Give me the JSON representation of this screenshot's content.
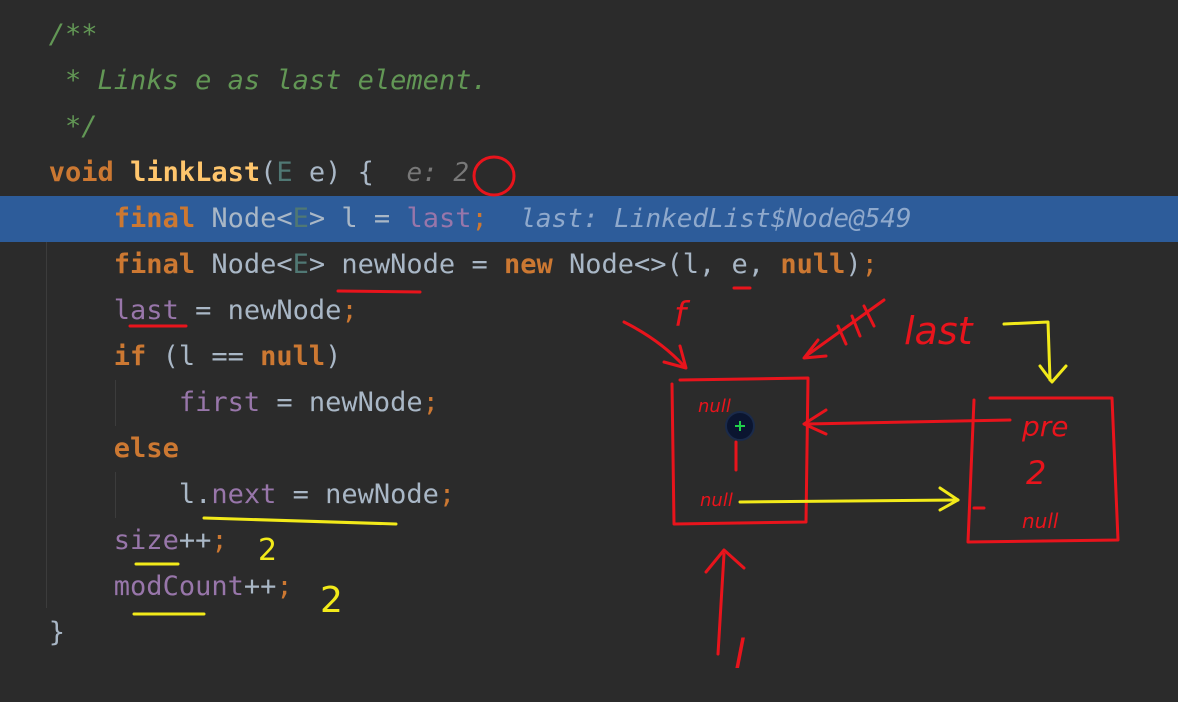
{
  "editor": {
    "line1": "/**",
    "line2": " * Links e as last element.",
    "line3": " */",
    "line4": {
      "kw": "void",
      "method": "linkLast",
      "open": "(",
      "type": "E",
      "param": " e) {",
      "hint": "e: 2"
    },
    "line5": {
      "kw": "final",
      "type": "Node<",
      "gen": "E",
      "type2": "> l = ",
      "field": "last",
      "semi": ";",
      "hint": "last: LinkedList$Node@549"
    },
    "line6": {
      "kw": "final",
      "type": "Node<",
      "gen": "E",
      "type2": "> newNode = ",
      "kw2": "new",
      "rest": " Node<>(l, e, ",
      "kw3": "null",
      "end": ")",
      "semi": ";"
    },
    "line7": {
      "field": "last",
      "rest": " = newNode",
      "semi": ";"
    },
    "line8": {
      "kw": "if",
      "rest": " (l == ",
      "kw2": "null",
      "end": ")"
    },
    "line9": {
      "field": "first",
      "rest": " = newNode",
      "semi": ";"
    },
    "line10": {
      "kw": "else"
    },
    "line11": {
      "pre": "l.",
      "field": "next",
      "rest": " = newNode",
      "semi": ";"
    },
    "line12": {
      "field": "size",
      "rest": "++",
      "semi": ";"
    },
    "line13": {
      "field": "modCount",
      "rest": "++",
      "semi": ";"
    },
    "line14": "}"
  },
  "annotations": {
    "top_f": "f",
    "label_last": "last",
    "node1_prev": "null",
    "node1_next": "null",
    "node2_prev": "pre",
    "node2_value": "2",
    "node2_next": "null",
    "bottom_l": "l",
    "size_value": "2",
    "modcount_value": "2"
  },
  "colors": {
    "background": "#2b2b2b",
    "highlight": "#2d5c9a",
    "keyword": "#cc7832",
    "field": "#9876aa",
    "comment": "#629755",
    "ink_red": "#e8141c",
    "ink_yellow": "#f2ea1a"
  }
}
